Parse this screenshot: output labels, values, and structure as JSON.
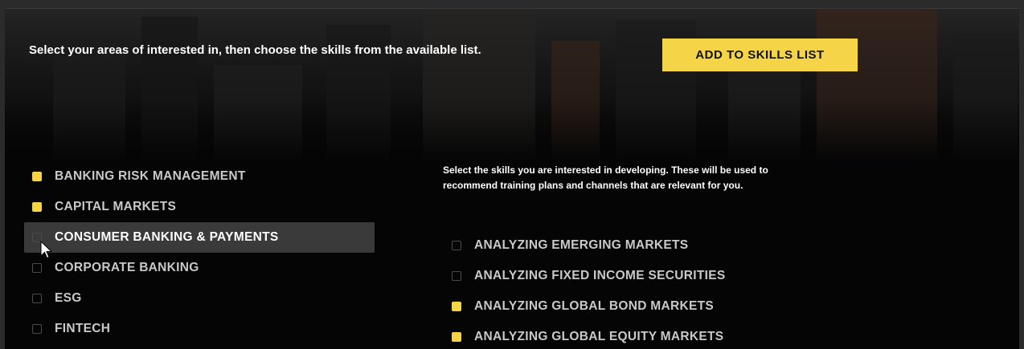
{
  "intro_text": "Select your areas of interested in, then choose the skills from the available list.",
  "add_button_label": "ADD TO SKILLS LIST",
  "areas": [
    {
      "label": "BANKING RISK MANAGEMENT",
      "checked": true
    },
    {
      "label": "CAPITAL MARKETS",
      "checked": true
    },
    {
      "label": "CONSUMER BANKING & PAYMENTS",
      "checked": false,
      "hovered": true
    },
    {
      "label": "CORPORATE BANKING",
      "checked": false
    },
    {
      "label": "ESG",
      "checked": false
    },
    {
      "label": "FINTECH",
      "checked": false
    }
  ],
  "skills_helper": "Select the skills you are interested in developing. These will be used to recommend training plans and channels that are relevant for you.",
  "skills": [
    {
      "label": "ANALYZING EMERGING MARKETS",
      "checked": false
    },
    {
      "label": "ANALYZING FIXED INCOME SECURITIES",
      "checked": false
    },
    {
      "label": "ANALYZING GLOBAL BOND MARKETS",
      "checked": true
    },
    {
      "label": "ANALYZING GLOBAL EQUITY MARKETS",
      "checked": true
    }
  ],
  "colors": {
    "accent": "#f5d547",
    "background": "#050505",
    "hover_row": "#3a3a3a"
  }
}
